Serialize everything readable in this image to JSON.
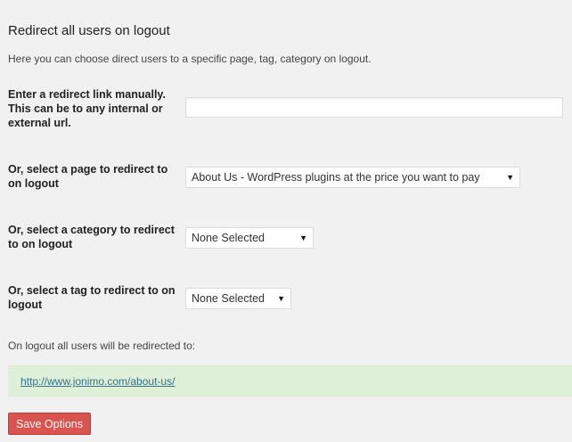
{
  "section": {
    "title": "Redirect all users on logout",
    "description": "Here you can choose direct users to a specific page, tag, category on logout."
  },
  "fields": {
    "manual_link": {
      "label": "Enter a redirect link manually. This can be to any internal or external url.",
      "value": "",
      "placeholder": ""
    },
    "page": {
      "label": "Or, select a page to redirect to on logout",
      "selected": "About Us - WordPress plugins at the price you want to pay"
    },
    "category": {
      "label": "Or, select a category to redirect to on logout",
      "selected": "None Selected"
    },
    "tag": {
      "label": "Or, select a tag to redirect to on logout",
      "selected": "None Selected"
    }
  },
  "result": {
    "note": "On logout all users will be redirected to:",
    "url": "http://www.jonimo.com/about-us/"
  },
  "actions": {
    "save_label": "Save Options"
  },
  "icons": {
    "dropdown": "▼"
  }
}
